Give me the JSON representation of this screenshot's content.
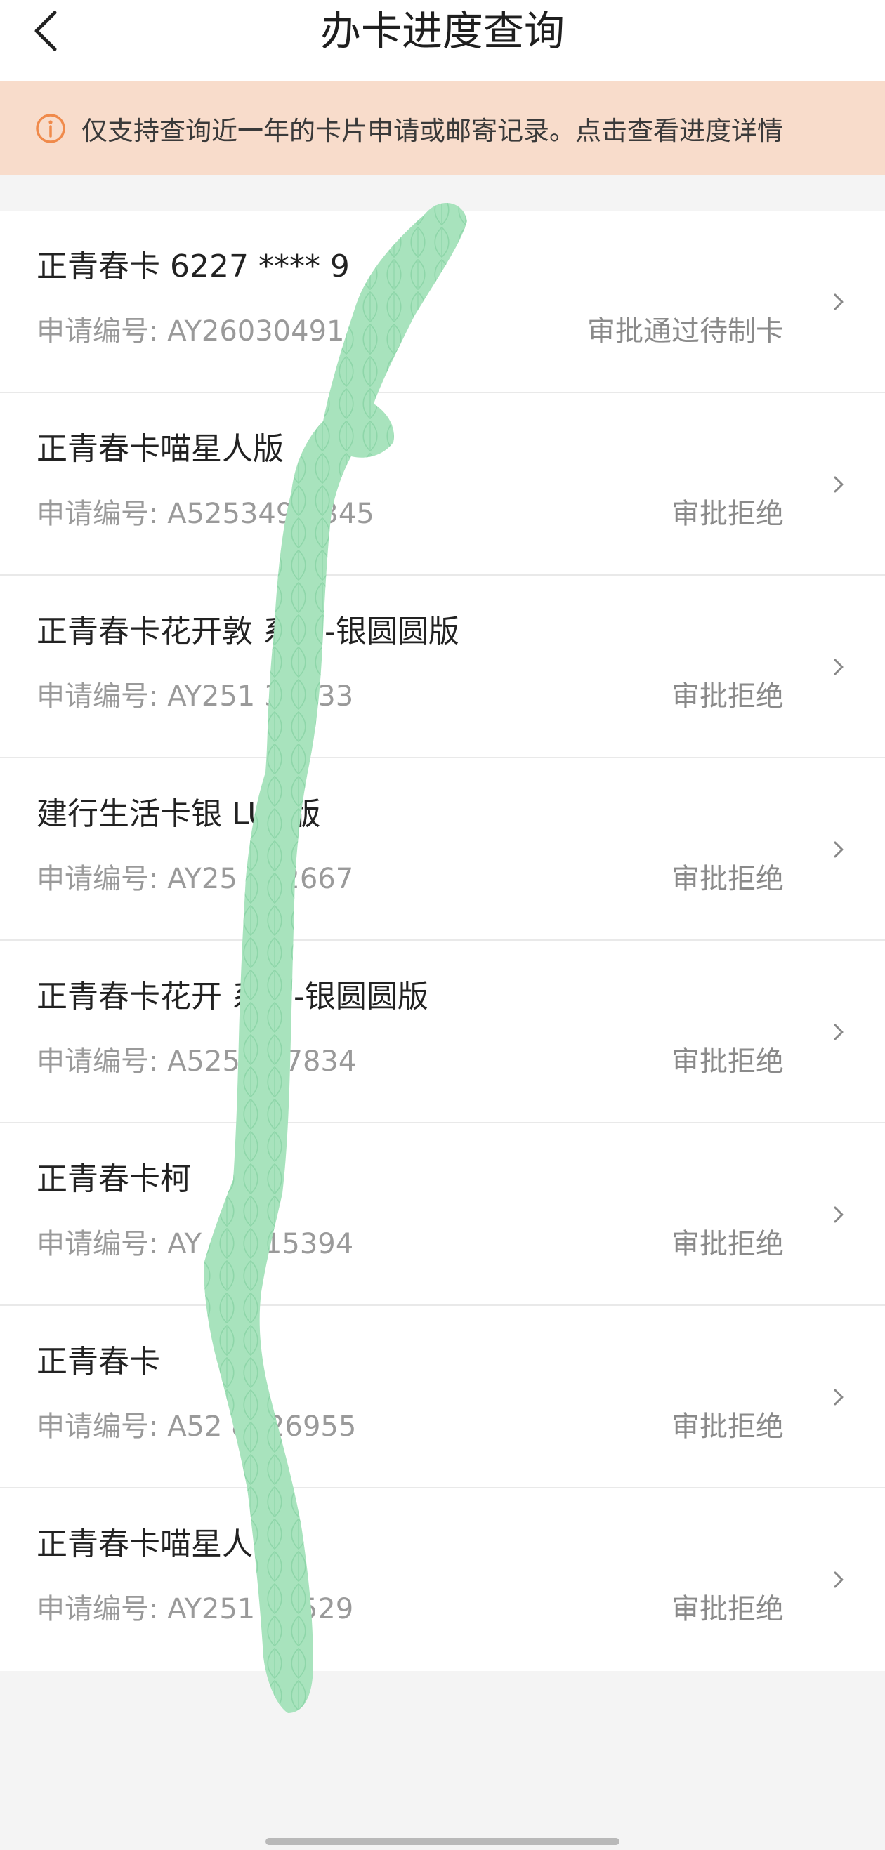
{
  "header": {
    "title": "办卡进度查询",
    "back_icon": "chevron-left-icon"
  },
  "notice": {
    "icon": "info-circle-icon",
    "icon_color": "#f08a4b",
    "text": "仅支持查询近一年的卡片申请或邮寄记录。点击查看进度详情",
    "background": "#f8dccb"
  },
  "applications": [
    {
      "card_name": "正青春卡   6227 **** 9",
      "app_no": "申请编号: AY26030491",
      "status": "审批通过待制卡"
    },
    {
      "card_name": "正青春卡喵星人版",
      "app_no": "申请编号: A525349   6345",
      "status": "审批拒绝"
    },
    {
      "card_name": "正青春卡花开敦   系列-银圆圆版",
      "app_no": "申请编号: AY251   34433",
      "status": "审批拒绝"
    },
    {
      "card_name": "建行生活卡银   LUS版",
      "app_no": "申请编号: AY25   532667",
      "status": "审批拒绝"
    },
    {
      "card_name": "正青春卡花开   系列-银圆圆版",
      "app_no": "申请编号: A525   497834",
      "status": "审批拒绝"
    },
    {
      "card_name": "正青春卡柯",
      "app_no": "申请编号: AY   32915394",
      "status": "审批拒绝"
    },
    {
      "card_name": "正青春卡",
      "app_no": "申请编号: A52   8826955",
      "status": "审批拒绝"
    },
    {
      "card_name": "正青春卡喵星人",
      "app_no": "申请编号: AY251   01529",
      "status": "审批拒绝"
    }
  ],
  "row_icon": "chevron-right-icon",
  "colors": {
    "scribble": "#a8e3bd",
    "scribble_pattern": "#86d2a2"
  }
}
